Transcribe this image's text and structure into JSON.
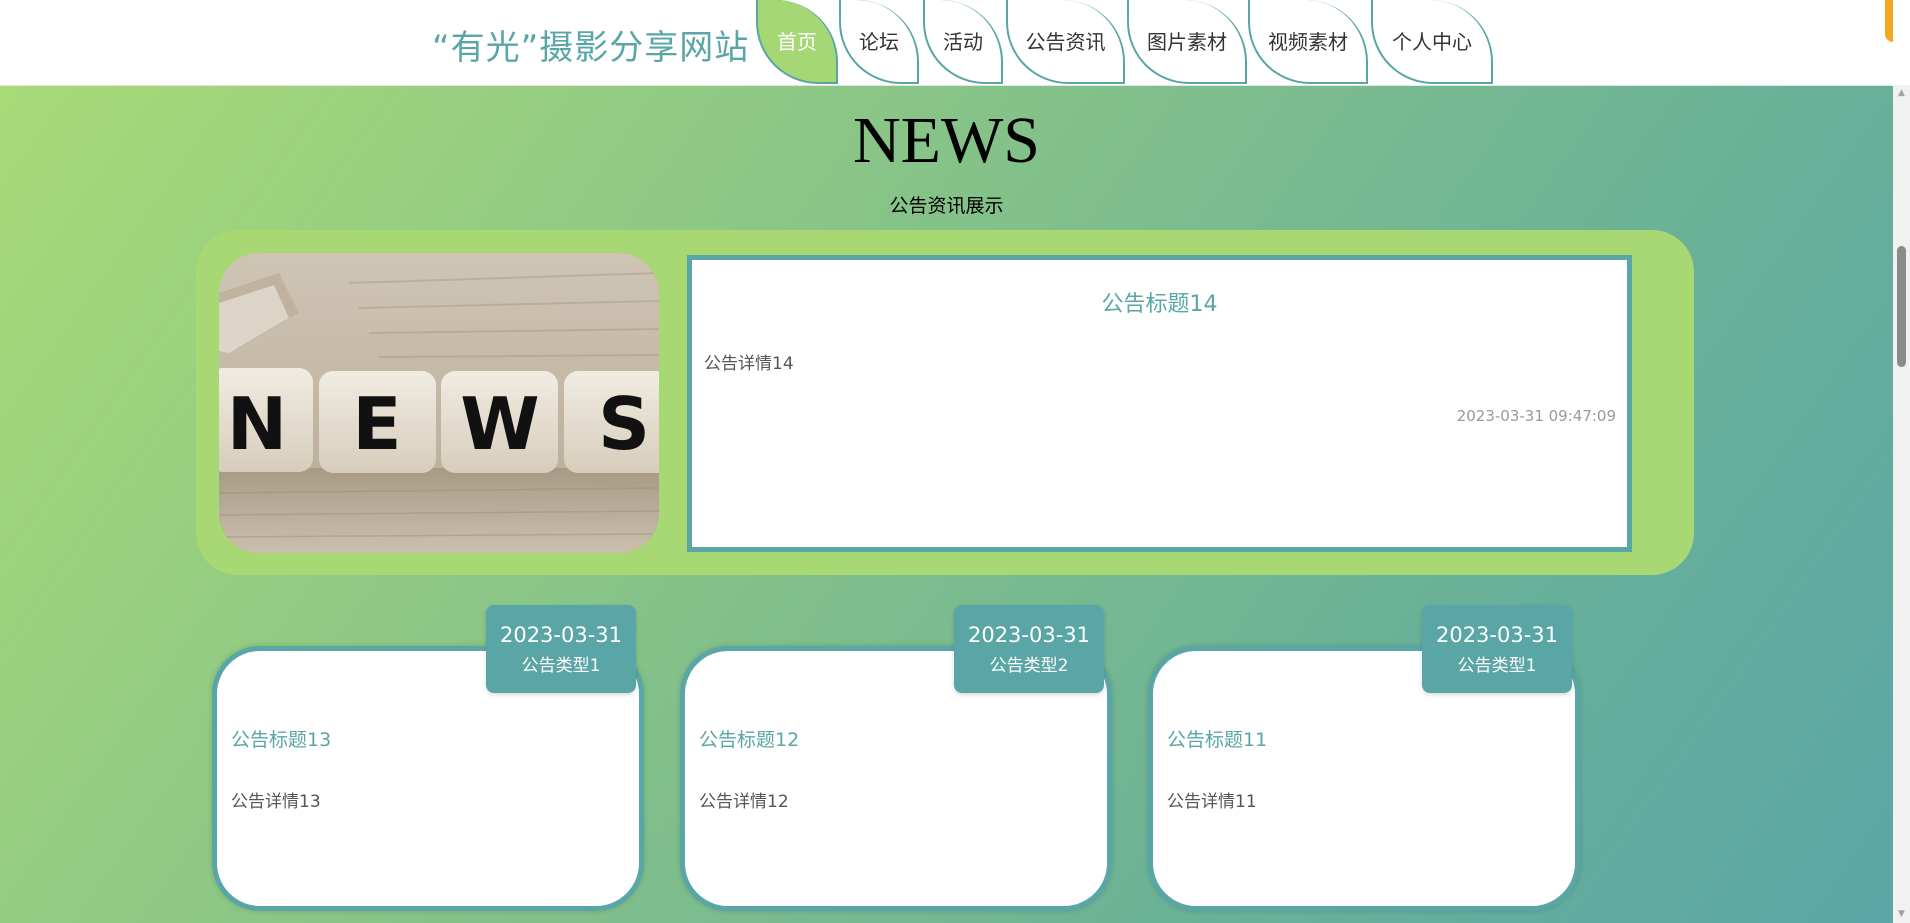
{
  "header": {
    "site_title": "“有光”摄影分享网站",
    "nav": [
      {
        "label": "首页",
        "active": true
      },
      {
        "label": "论坛",
        "active": false
      },
      {
        "label": "活动",
        "active": false
      },
      {
        "label": "公告资讯",
        "active": false
      },
      {
        "label": "图片素材",
        "active": false
      },
      {
        "label": "视频素材",
        "active": false
      },
      {
        "label": "个人中心",
        "active": false
      }
    ]
  },
  "news": {
    "heading": "NEWS",
    "subheading": "公告资讯展示",
    "featured": {
      "image_text": "NEWS",
      "title": "公告标题14",
      "detail": "公告详情14",
      "time": "2023-03-31 09:47:09"
    },
    "cards": [
      {
        "date": "2023-03-31",
        "type": "公告类型1",
        "title": "公告标题13",
        "detail": "公告详情13"
      },
      {
        "date": "2023-03-31",
        "type": "公告类型2",
        "title": "公告标题12",
        "detail": "公告详情12"
      },
      {
        "date": "2023-03-31",
        "type": "公告类型1",
        "title": "公告标题11",
        "detail": "公告详情11"
      }
    ]
  },
  "colors": {
    "accent": "#5aa6a6",
    "active_nav": "#a5d874",
    "featured_bg": "#a8d874",
    "gradient_start": "#a9da78",
    "gradient_end": "#5aa6a6"
  }
}
